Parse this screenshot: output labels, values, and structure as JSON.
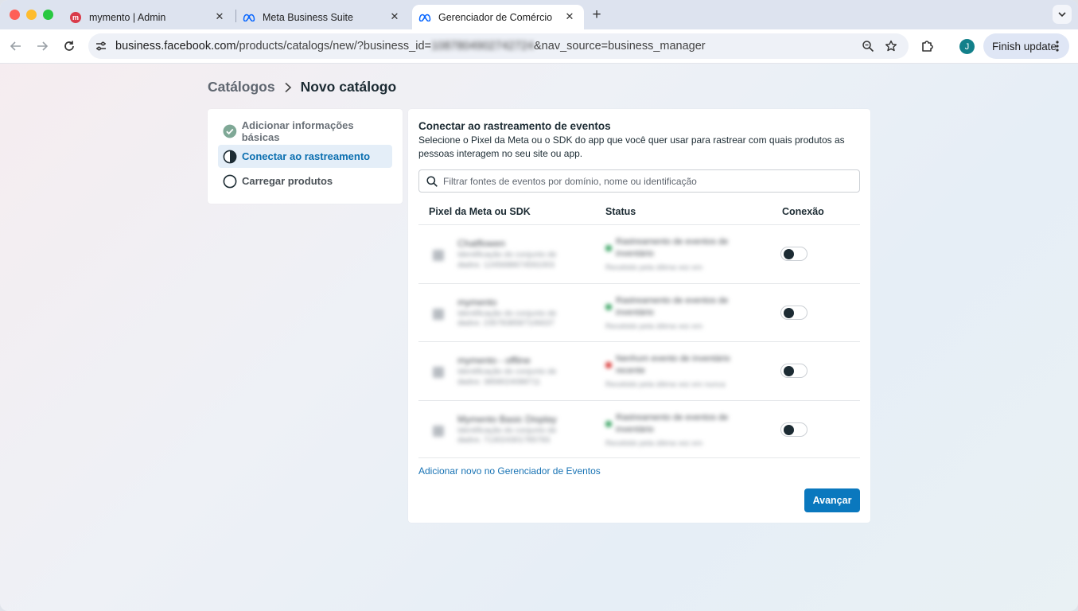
{
  "browser": {
    "tabs": [
      {
        "title": "mymento | Admin",
        "favicon": "mymento-icon"
      },
      {
        "title": "Meta Business Suite",
        "favicon": "meta-icon"
      },
      {
        "title": "Gerenciador de Comércio",
        "favicon": "meta-icon",
        "active": true
      }
    ],
    "url": {
      "host": "business.facebook.com",
      "path": "/products/catalogs/new/?business_id=",
      "redacted_id": "1087804902742724",
      "tail": "&nav_source=business_manager"
    },
    "profile_initial": "J",
    "finish_update_label": "Finish update"
  },
  "breadcrumb": {
    "root": "Catálogos",
    "current": "Novo catálogo"
  },
  "steps": [
    {
      "label": "Adicionar informações básicas",
      "state": "done"
    },
    {
      "label": "Conectar ao rastreamento",
      "state": "current"
    },
    {
      "label": "Carregar produtos",
      "state": "todo"
    }
  ],
  "main": {
    "title": "Conectar ao rastreamento de eventos",
    "description": "Selecione o Pixel da Meta ou o SDK do app que você quer usar para rastrear com quais produtos as pessoas interagem no seu site ou app.",
    "filter_placeholder": "Filtrar fontes de eventos por domínio, nome ou identificação",
    "columns": {
      "source": "Pixel da Meta ou SDK",
      "status": "Status",
      "connection": "Conexão"
    },
    "rows": [
      {
        "name": "Chatflowen",
        "sub": "Identificação do conjunto de dados: 1245688674591003",
        "status": "Rastreamento de eventos de inventário",
        "status_sub": "Recebido pela última vez em",
        "status_color": "#2f9e5b"
      },
      {
        "name": "mymento",
        "sub": "Identificação do conjunto de dados: 2357838587106637",
        "status": "Rastreamento de eventos de inventário",
        "status_sub": "Recebido pela última vez em",
        "status_color": "#2f9e5b"
      },
      {
        "name": "mymento - offline",
        "sub": "Identificação do conjunto de dados: 3858024088711",
        "status": "Nenhum evento de inventário recente",
        "status_sub": "Recebido pela última vez em nunca",
        "status_color": "#d6312f"
      },
      {
        "name": "Mymento Basic Display",
        "sub": "Identificação do conjunto de dados: 713024301785783",
        "status": "Rastreamento de eventos de inventário",
        "status_sub": "Recebido pela última vez em",
        "status_color": "#2f9e5b"
      }
    ],
    "add_link": "Adicionar novo no Gerenciador de Eventos",
    "advance_label": "Avançar"
  }
}
